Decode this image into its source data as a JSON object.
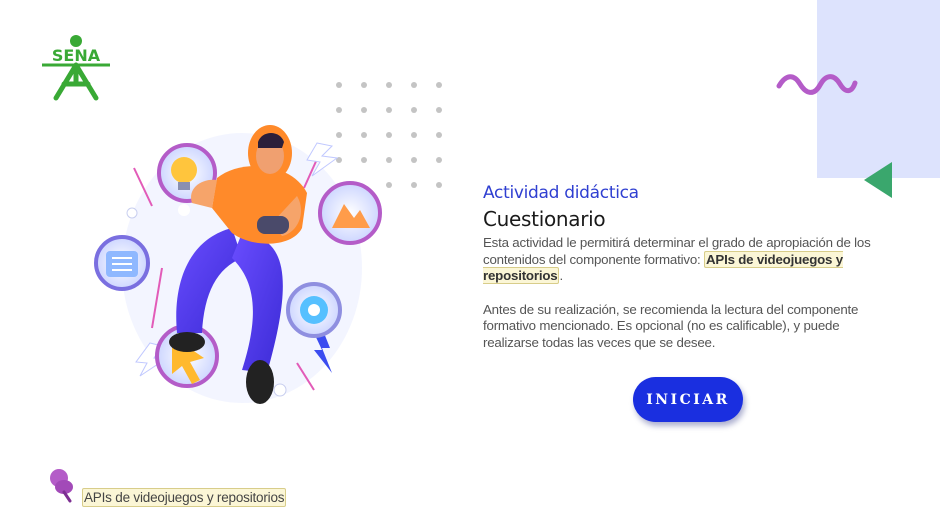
{
  "logo": {
    "text": "SENA",
    "color": "#39a935"
  },
  "activity": {
    "kicker": "Actividad didáctica",
    "title": "Cuestionario",
    "desc_part1": "Esta actividad le permitirá determinar el grado de apropiación de los contenidos del componente formativo: ",
    "highlight": "APIs de videojuegos y repositorios",
    "desc_part2": ".",
    "desc2": "Antes de su realización, se recomienda la lectura del componente formativo mencionado.  Es opcional (no es calificable), y puede realizarse todas las veces que se desee."
  },
  "start_button": {
    "label": "INICIAR",
    "color": "#1a2fe0"
  },
  "footer": {
    "link": "APIs de videojuegos y repositorios",
    "icon": "pin-icon"
  },
  "colors": {
    "deco_rect": "#dde3fd",
    "wave": "#b45cc8",
    "triangle": "#3aa76d",
    "dots": "#bdbdbd"
  }
}
